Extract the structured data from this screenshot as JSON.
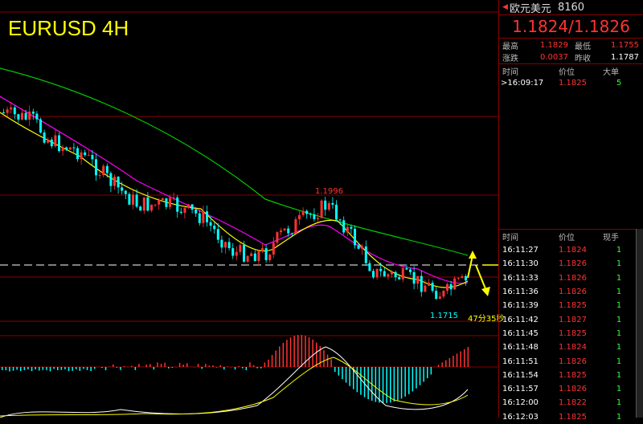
{
  "chart": {
    "title": "EURUSD 4H",
    "high_label": "1.1996",
    "low_label": "1.1715",
    "countdown": "47分35秒"
  },
  "quote": {
    "name": "欧元美元",
    "code": "8160",
    "price": "1.1824/1.1826",
    "high_label": "最高",
    "high": "1.1829",
    "low_label": "最低",
    "low": "1.1755",
    "change_label": "涨跌",
    "change": "0.0037",
    "prev_label": "昨收",
    "prev": "1.1787"
  },
  "big_trades": {
    "headers": [
      "时间",
      "价位",
      "大单"
    ],
    "rows": [
      {
        "time": ">16:09:17",
        "price": "1.1825",
        "vol": "5"
      }
    ]
  },
  "ticks": {
    "headers": [
      "时间",
      "价位",
      "现手"
    ],
    "rows": [
      {
        "time": "16:11:27",
        "price": "1.1824",
        "vol": "1"
      },
      {
        "time": "16:11:30",
        "price": "1.1826",
        "vol": "1"
      },
      {
        "time": "16:11:33",
        "price": "1.1826",
        "vol": "1"
      },
      {
        "time": "16:11:36",
        "price": "1.1826",
        "vol": "1"
      },
      {
        "time": "16:11:39",
        "price": "1.1825",
        "vol": "1"
      },
      {
        "time": "16:11:42",
        "price": "1.1827",
        "vol": "1"
      },
      {
        "time": "16:11:45",
        "price": "1.1825",
        "vol": "1"
      },
      {
        "time": "16:11:48",
        "price": "1.1824",
        "vol": "1"
      },
      {
        "time": "16:11:51",
        "price": "1.1826",
        "vol": "1"
      },
      {
        "time": "16:11:54",
        "price": "1.1825",
        "vol": "1"
      },
      {
        "time": "16:11:57",
        "price": "1.1826",
        "vol": "1"
      },
      {
        "time": "16:12:00",
        "price": "1.1822",
        "vol": "1"
      },
      {
        "time": "16:12:03",
        "price": "1.1825",
        "vol": "1"
      }
    ]
  },
  "colors": {
    "up": "#ff3333",
    "down": "#00ffff",
    "ma_fast": "#ffff00",
    "ma_mid": "#ff00ff",
    "ma_slow": "#00cc00",
    "grid": "#8b0000"
  }
}
